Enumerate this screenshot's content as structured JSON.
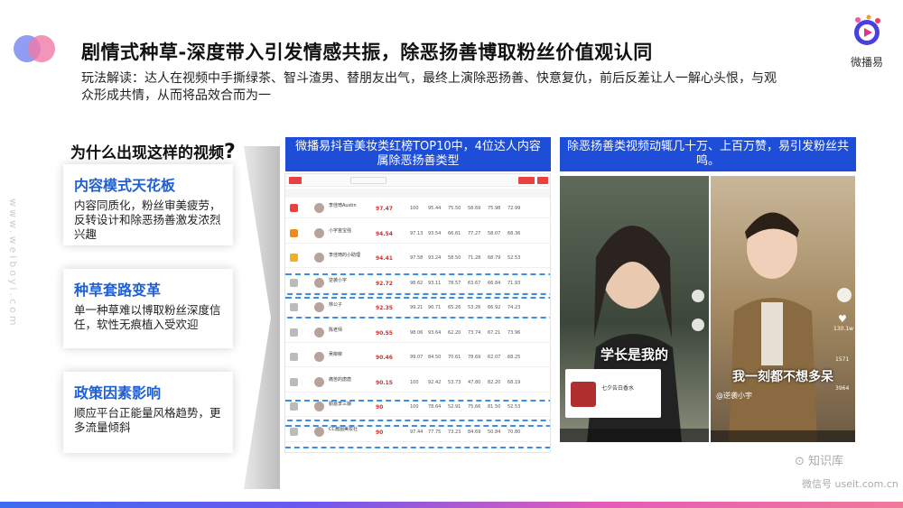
{
  "title": "剧情式种草-深度带入引发情感共振，除恶扬善博取粉丝价值观认同",
  "description_label": "玩法解读：达人在视频中手撕绿茶、智斗渣男、替朋友出气，最终上演除恶扬善、快意复仇，前后反差让人一解心头恨，与观众形成共情，从而将品效合而为一",
  "brand": {
    "name": "微播易",
    "side_url": "www.weiboyi.com"
  },
  "why_heading": "为什么出现这样的视频",
  "why_mark": "?",
  "cards": [
    {
      "title": "内容模式天花板",
      "text": "内容同质化，粉丝审美疲劳，反转设计和除恶扬善激发浓烈兴趣"
    },
    {
      "title": "种草套路变革",
      "text": "单一种草难以博取粉丝深度信任，软性无痕植入受欢迎"
    },
    {
      "title": "政策因素影响",
      "text": "顺应平台正能量风格趋势，更多流量倾斜"
    }
  ],
  "tag_left": "微播易抖音美妆类红榜TOP10中，4位达人内容属除恶扬善类型",
  "tag_right": "除恶扬善类视频动辄几十万、上百万赞，易引发粉丝共鸣。",
  "table": {
    "rows": [
      {
        "name": "李佳琦Austin",
        "score": "97.47",
        "vals": [
          "100",
          "95.44",
          "75.50",
          "58.69",
          "75.98",
          "72.99"
        ],
        "rank_color": "#e94040"
      },
      {
        "name": "小宇宙宝强",
        "score": "94.54",
        "vals": [
          "97.13",
          "93.54",
          "66.61",
          "77.27",
          "58.07",
          "68.36"
        ],
        "rank_color": "#f08a20"
      },
      {
        "name": "李佳琦的小助理",
        "score": "94.41",
        "vals": [
          "97.58",
          "93.24",
          "58.50",
          "71.28",
          "68.79",
          "52.53"
        ],
        "rank_color": "#f0b020"
      },
      {
        "name": "逆袭小宇",
        "score": "92.72",
        "vals": [
          "98.62",
          "93.11",
          "78.57",
          "63.67",
          "66.84",
          "71.93"
        ],
        "rank_color": "#bbbbbb"
      },
      {
        "name": "林公子",
        "score": "92.35",
        "vals": [
          "99.21",
          "90.71",
          "65.26",
          "53.26",
          "66.92",
          "74.23"
        ],
        "rank_color": "#bbbbbb"
      },
      {
        "name": "陈老师",
        "score": "90.55",
        "vals": [
          "98.06",
          "93.64",
          "62.20",
          "73.74",
          "67.21",
          "73.96"
        ],
        "rank_color": "#bbbbbb"
      },
      {
        "name": "吴柳柳",
        "score": "90.46",
        "vals": [
          "99.07",
          "84.50",
          "70.61",
          "78.69",
          "62.07",
          "68.25"
        ],
        "rank_color": "#bbbbbb"
      },
      {
        "name": "痛苦的唐唐",
        "score": "90.15",
        "vals": [
          "100",
          "92.42",
          "53.73",
          "47.80",
          "82.20",
          "68.19"
        ],
        "rank_color": "#bbbbbb"
      },
      {
        "name": "勤嘉李三娘",
        "score": "90",
        "vals": [
          "100",
          "78.64",
          "52.91",
          "75.66",
          "81.50",
          "52.53"
        ],
        "rank_color": "#bbbbbb"
      },
      {
        "name": "CC酱图美妆社",
        "score": "90",
        "vals": [
          "97.44",
          "77.75",
          "73.23",
          "84.69",
          "50.84",
          "70.80"
        ],
        "rank_color": "#bbbbbb"
      }
    ]
  },
  "video1": {
    "caption": "学长是我的",
    "product": "七夕告白香水"
  },
  "video2": {
    "caption": "我一刻都不想多呆",
    "account": "@逆袭小宇",
    "likes": "130.1w",
    "comments": "1571",
    "shares": "3964"
  },
  "watermark": {
    "name": "知识库",
    "sub": "微信号 useit.com.cn"
  }
}
